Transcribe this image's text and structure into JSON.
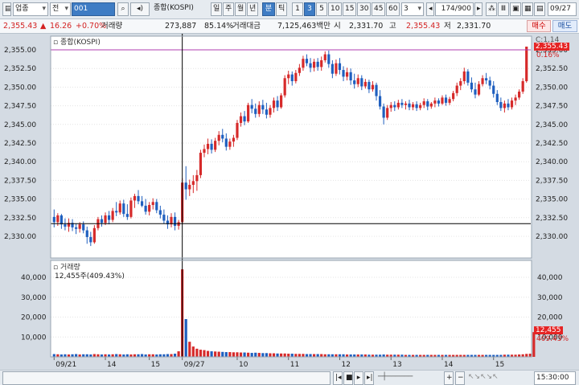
{
  "toolbar": {
    "market": "업종",
    "type": "전",
    "code": "001",
    "name": "종합(KOSPI)",
    "periods": [
      "일",
      "주",
      "월",
      "년",
      "분",
      "틱"
    ],
    "selected_period": "분",
    "intervals": [
      "1",
      "3",
      "5",
      "10",
      "15",
      "30",
      "45",
      "60"
    ],
    "selected_interval": "3",
    "interval_select": "3",
    "count": "174/900",
    "date": "09/27"
  },
  "info": {
    "price": "2,355.43",
    "change_arrow": "▲",
    "change": "16.26",
    "change_pct": "+0.70%",
    "volume_label": "거래량",
    "volume": "273,887",
    "volume_pct": "85.14%",
    "amount_label": "거래대금",
    "amount": "7,125,463백만",
    "open_label": "시",
    "open": "2,331.70",
    "high_label": "고",
    "high": "2,355.43",
    "low_label": "저",
    "low": "2,331.70",
    "buy_label": "매수",
    "sell_label": "매도"
  },
  "price_panel": {
    "legend": "종합(KOSPI)",
    "corner_label": "C:1,14",
    "current_price_label": "2,355.43",
    "current_pct_label": "0.16%",
    "y_ticks": [
      "2,355.00",
      "2,352.50",
      "2,350.00",
      "2,347.50",
      "2,345.00",
      "2,342.50",
      "2,340.00",
      "2,337.50",
      "2,335.00",
      "2,332.50",
      "2,330.00"
    ]
  },
  "volume_panel": {
    "legend": "거래량",
    "current_label": "12,455주(409.43%)",
    "current_value_label": "12,455",
    "current_pct_label": "409.43%",
    "y_ticks": [
      "40,000",
      "30,000",
      "20,000",
      "10,000"
    ]
  },
  "x_axis": {
    "labels": [
      "09/21",
      "14",
      "15",
      "09/27",
      "10",
      "11",
      "12",
      "13",
      "14",
      "15"
    ],
    "time_label": "15:30:00"
  },
  "colors": {
    "up": "#d62a2a",
    "down": "#1f5fbf",
    "crosshair": "#000000",
    "high_line": "#b23cb2"
  },
  "chart_data": {
    "type": "candlestick",
    "title": "종합(KOSPI)",
    "interval": "3분",
    "ylim": [
      2328.0,
      2356.0
    ],
    "crosshair_price": 2331.7,
    "candles": [
      {
        "o": 2332.6,
        "h": 2333.6,
        "l": 2331.2,
        "c": 2331.9
      },
      {
        "o": 2331.9,
        "h": 2333.1,
        "l": 2331.4,
        "c": 2332.8
      },
      {
        "o": 2332.8,
        "h": 2333.0,
        "l": 2331.0,
        "c": 2331.6
      },
      {
        "o": 2331.6,
        "h": 2332.4,
        "l": 2330.8,
        "c": 2331.3
      },
      {
        "o": 2331.3,
        "h": 2332.4,
        "l": 2330.6,
        "c": 2331.8
      },
      {
        "o": 2331.8,
        "h": 2332.3,
        "l": 2330.7,
        "c": 2331.2
      },
      {
        "o": 2331.2,
        "h": 2331.7,
        "l": 2330.3,
        "c": 2331.0
      },
      {
        "o": 2331.0,
        "h": 2331.9,
        "l": 2330.5,
        "c": 2331.6
      },
      {
        "o": 2331.6,
        "h": 2332.0,
        "l": 2330.4,
        "c": 2330.8
      },
      {
        "o": 2330.8,
        "h": 2331.3,
        "l": 2329.0,
        "c": 2329.9
      },
      {
        "o": 2329.9,
        "h": 2330.6,
        "l": 2328.7,
        "c": 2329.2
      },
      {
        "o": 2329.2,
        "h": 2331.5,
        "l": 2329.0,
        "c": 2331.1
      },
      {
        "o": 2331.1,
        "h": 2332.6,
        "l": 2330.8,
        "c": 2332.3
      },
      {
        "o": 2332.3,
        "h": 2332.8,
        "l": 2331.3,
        "c": 2331.8
      },
      {
        "o": 2331.8,
        "h": 2333.2,
        "l": 2331.5,
        "c": 2332.8
      },
      {
        "o": 2332.8,
        "h": 2333.4,
        "l": 2331.6,
        "c": 2332.2
      },
      {
        "o": 2332.2,
        "h": 2333.8,
        "l": 2331.9,
        "c": 2333.4
      },
      {
        "o": 2333.4,
        "h": 2334.6,
        "l": 2332.7,
        "c": 2333.2
      },
      {
        "o": 2333.2,
        "h": 2334.8,
        "l": 2332.9,
        "c": 2334.4
      },
      {
        "o": 2334.4,
        "h": 2334.9,
        "l": 2332.6,
        "c": 2333.0
      },
      {
        "o": 2333.0,
        "h": 2334.3,
        "l": 2332.2,
        "c": 2332.6
      },
      {
        "o": 2332.6,
        "h": 2335.2,
        "l": 2332.4,
        "c": 2334.8
      },
      {
        "o": 2334.8,
        "h": 2335.7,
        "l": 2333.8,
        "c": 2335.4
      },
      {
        "o": 2335.4,
        "h": 2336.2,
        "l": 2334.3,
        "c": 2334.7
      },
      {
        "o": 2334.7,
        "h": 2335.4,
        "l": 2333.9,
        "c": 2334.1
      },
      {
        "o": 2334.1,
        "h": 2335.0,
        "l": 2332.9,
        "c": 2333.3
      },
      {
        "o": 2333.3,
        "h": 2334.6,
        "l": 2332.8,
        "c": 2334.2
      },
      {
        "o": 2334.2,
        "h": 2335.1,
        "l": 2333.6,
        "c": 2334.6
      },
      {
        "o": 2334.6,
        "h": 2335.0,
        "l": 2333.1,
        "c": 2333.5
      },
      {
        "o": 2333.5,
        "h": 2334.1,
        "l": 2332.4,
        "c": 2332.9
      },
      {
        "o": 2332.9,
        "h": 2333.6,
        "l": 2331.7,
        "c": 2332.1
      },
      {
        "o": 2332.1,
        "h": 2332.8,
        "l": 2331.0,
        "c": 2331.6
      },
      {
        "o": 2331.6,
        "h": 2333.1,
        "l": 2331.2,
        "c": 2332.6
      },
      {
        "o": 2332.6,
        "h": 2333.2,
        "l": 2330.8,
        "c": 2331.4
      },
      {
        "o": 2331.4,
        "h": 2332.2,
        "l": 2330.9,
        "c": 2331.9
      },
      {
        "o": 2331.9,
        "h": 2337.8,
        "l": 2331.6,
        "c": 2337.2
      },
      {
        "o": 2337.2,
        "h": 2339.4,
        "l": 2334.9,
        "c": 2336.3
      },
      {
        "o": 2336.3,
        "h": 2337.6,
        "l": 2335.4,
        "c": 2336.9
      },
      {
        "o": 2336.9,
        "h": 2338.2,
        "l": 2335.8,
        "c": 2337.4
      },
      {
        "o": 2337.4,
        "h": 2338.9,
        "l": 2336.1,
        "c": 2338.2
      },
      {
        "o": 2338.2,
        "h": 2341.6,
        "l": 2337.8,
        "c": 2341.2
      },
      {
        "o": 2341.2,
        "h": 2342.3,
        "l": 2340.6,
        "c": 2341.7
      },
      {
        "o": 2341.7,
        "h": 2343.1,
        "l": 2341.0,
        "c": 2342.4
      },
      {
        "o": 2342.4,
        "h": 2343.0,
        "l": 2341.1,
        "c": 2341.6
      },
      {
        "o": 2341.6,
        "h": 2343.2,
        "l": 2341.3,
        "c": 2342.8
      },
      {
        "o": 2342.8,
        "h": 2344.1,
        "l": 2342.2,
        "c": 2343.6
      },
      {
        "o": 2343.6,
        "h": 2344.4,
        "l": 2342.6,
        "c": 2343.1
      },
      {
        "o": 2343.1,
        "h": 2343.8,
        "l": 2341.5,
        "c": 2342.0
      },
      {
        "o": 2342.0,
        "h": 2343.1,
        "l": 2341.6,
        "c": 2342.7
      },
      {
        "o": 2342.7,
        "h": 2343.6,
        "l": 2342.0,
        "c": 2343.2
      },
      {
        "o": 2343.2,
        "h": 2345.6,
        "l": 2342.9,
        "c": 2345.2
      },
      {
        "o": 2345.2,
        "h": 2346.6,
        "l": 2344.7,
        "c": 2346.1
      },
      {
        "o": 2346.1,
        "h": 2346.8,
        "l": 2344.9,
        "c": 2345.4
      },
      {
        "o": 2345.4,
        "h": 2347.9,
        "l": 2345.2,
        "c": 2347.6
      },
      {
        "o": 2347.6,
        "h": 2348.4,
        "l": 2346.5,
        "c": 2347.1
      },
      {
        "o": 2347.1,
        "h": 2347.8,
        "l": 2345.9,
        "c": 2346.4
      },
      {
        "o": 2346.4,
        "h": 2348.1,
        "l": 2346.0,
        "c": 2347.6
      },
      {
        "o": 2347.6,
        "h": 2348.3,
        "l": 2346.4,
        "c": 2347.0
      },
      {
        "o": 2347.0,
        "h": 2347.9,
        "l": 2345.8,
        "c": 2346.3
      },
      {
        "o": 2346.3,
        "h": 2347.6,
        "l": 2345.9,
        "c": 2347.2
      },
      {
        "o": 2347.2,
        "h": 2348.6,
        "l": 2346.6,
        "c": 2348.2
      },
      {
        "o": 2348.2,
        "h": 2348.8,
        "l": 2346.8,
        "c": 2347.3
      },
      {
        "o": 2347.3,
        "h": 2349.2,
        "l": 2347.1,
        "c": 2348.9
      },
      {
        "o": 2348.9,
        "h": 2351.6,
        "l": 2348.6,
        "c": 2351.2
      },
      {
        "o": 2351.2,
        "h": 2352.2,
        "l": 2350.4,
        "c": 2351.7
      },
      {
        "o": 2351.7,
        "h": 2352.1,
        "l": 2350.2,
        "c": 2350.8
      },
      {
        "o": 2350.8,
        "h": 2352.3,
        "l": 2350.5,
        "c": 2351.9
      },
      {
        "o": 2351.9,
        "h": 2353.1,
        "l": 2351.5,
        "c": 2352.6
      },
      {
        "o": 2352.6,
        "h": 2354.2,
        "l": 2352.2,
        "c": 2353.8
      },
      {
        "o": 2353.8,
        "h": 2354.4,
        "l": 2352.8,
        "c": 2353.2
      },
      {
        "o": 2353.2,
        "h": 2353.9,
        "l": 2352.0,
        "c": 2352.6
      },
      {
        "o": 2352.6,
        "h": 2353.8,
        "l": 2352.1,
        "c": 2353.4
      },
      {
        "o": 2353.4,
        "h": 2353.9,
        "l": 2352.2,
        "c": 2352.7
      },
      {
        "o": 2352.7,
        "h": 2354.1,
        "l": 2352.2,
        "c": 2353.6
      },
      {
        "o": 2353.6,
        "h": 2354.8,
        "l": 2353.3,
        "c": 2354.4
      },
      {
        "o": 2354.4,
        "h": 2354.9,
        "l": 2352.6,
        "c": 2353.1
      },
      {
        "o": 2353.1,
        "h": 2353.6,
        "l": 2351.2,
        "c": 2351.8
      },
      {
        "o": 2351.8,
        "h": 2353.7,
        "l": 2351.5,
        "c": 2353.2
      },
      {
        "o": 2353.2,
        "h": 2353.9,
        "l": 2351.7,
        "c": 2352.3
      },
      {
        "o": 2352.3,
        "h": 2352.8,
        "l": 2350.8,
        "c": 2351.4
      },
      {
        "o": 2351.4,
        "h": 2352.6,
        "l": 2350.9,
        "c": 2352.0
      },
      {
        "o": 2352.0,
        "h": 2352.5,
        "l": 2350.3,
        "c": 2350.9
      },
      {
        "o": 2350.9,
        "h": 2351.8,
        "l": 2349.8,
        "c": 2350.4
      },
      {
        "o": 2350.4,
        "h": 2351.7,
        "l": 2350.0,
        "c": 2351.2
      },
      {
        "o": 2351.2,
        "h": 2351.6,
        "l": 2349.6,
        "c": 2350.1
      },
      {
        "o": 2350.1,
        "h": 2351.1,
        "l": 2349.8,
        "c": 2350.7
      },
      {
        "o": 2350.7,
        "h": 2351.0,
        "l": 2349.2,
        "c": 2349.7
      },
      {
        "o": 2349.7,
        "h": 2350.8,
        "l": 2349.4,
        "c": 2350.3
      },
      {
        "o": 2350.3,
        "h": 2350.6,
        "l": 2348.2,
        "c": 2348.8
      },
      {
        "o": 2348.8,
        "h": 2349.6,
        "l": 2347.0,
        "c": 2347.4
      },
      {
        "o": 2347.4,
        "h": 2347.8,
        "l": 2345.0,
        "c": 2345.9
      },
      {
        "o": 2345.9,
        "h": 2347.6,
        "l": 2345.6,
        "c": 2347.2
      },
      {
        "o": 2347.2,
        "h": 2348.0,
        "l": 2346.7,
        "c": 2347.6
      },
      {
        "o": 2347.6,
        "h": 2348.1,
        "l": 2346.8,
        "c": 2347.3
      },
      {
        "o": 2347.3,
        "h": 2348.3,
        "l": 2347.0,
        "c": 2347.9
      },
      {
        "o": 2347.9,
        "h": 2348.4,
        "l": 2347.2,
        "c": 2347.6
      },
      {
        "o": 2347.6,
        "h": 2348.1,
        "l": 2347.0,
        "c": 2347.8
      },
      {
        "o": 2347.8,
        "h": 2348.3,
        "l": 2346.9,
        "c": 2347.3
      },
      {
        "o": 2347.3,
        "h": 2348.0,
        "l": 2346.9,
        "c": 2347.7
      },
      {
        "o": 2347.7,
        "h": 2348.1,
        "l": 2346.8,
        "c": 2347.2
      },
      {
        "o": 2347.2,
        "h": 2347.9,
        "l": 2346.9,
        "c": 2347.6
      },
      {
        "o": 2347.6,
        "h": 2348.5,
        "l": 2347.2,
        "c": 2348.1
      },
      {
        "o": 2348.1,
        "h": 2348.4,
        "l": 2346.9,
        "c": 2347.4
      },
      {
        "o": 2347.4,
        "h": 2348.0,
        "l": 2347.1,
        "c": 2347.8
      },
      {
        "o": 2347.8,
        "h": 2348.6,
        "l": 2347.3,
        "c": 2348.2
      },
      {
        "o": 2348.2,
        "h": 2348.5,
        "l": 2347.4,
        "c": 2347.8
      },
      {
        "o": 2347.8,
        "h": 2348.9,
        "l": 2347.6,
        "c": 2348.6
      },
      {
        "o": 2348.6,
        "h": 2349.0,
        "l": 2347.5,
        "c": 2347.9
      },
      {
        "o": 2347.9,
        "h": 2348.7,
        "l": 2347.6,
        "c": 2348.4
      },
      {
        "o": 2348.4,
        "h": 2349.5,
        "l": 2348.1,
        "c": 2349.2
      },
      {
        "o": 2349.2,
        "h": 2350.6,
        "l": 2348.8,
        "c": 2350.2
      },
      {
        "o": 2350.2,
        "h": 2351.2,
        "l": 2349.6,
        "c": 2350.8
      },
      {
        "o": 2350.8,
        "h": 2352.6,
        "l": 2350.4,
        "c": 2352.1
      },
      {
        "o": 2352.1,
        "h": 2352.4,
        "l": 2350.2,
        "c": 2350.6
      },
      {
        "o": 2350.6,
        "h": 2351.3,
        "l": 2349.3,
        "c": 2349.7
      },
      {
        "o": 2349.7,
        "h": 2350.6,
        "l": 2348.5,
        "c": 2349.0
      },
      {
        "o": 2349.0,
        "h": 2350.8,
        "l": 2348.8,
        "c": 2350.4
      },
      {
        "o": 2350.4,
        "h": 2351.6,
        "l": 2350.1,
        "c": 2351.2
      },
      {
        "o": 2351.2,
        "h": 2351.9,
        "l": 2350.4,
        "c": 2350.9
      },
      {
        "o": 2350.9,
        "h": 2351.4,
        "l": 2349.7,
        "c": 2350.2
      },
      {
        "o": 2350.2,
        "h": 2350.8,
        "l": 2348.6,
        "c": 2349.1
      },
      {
        "o": 2349.1,
        "h": 2349.6,
        "l": 2347.6,
        "c": 2348.0
      },
      {
        "o": 2348.0,
        "h": 2348.6,
        "l": 2346.8,
        "c": 2347.2
      },
      {
        "o": 2347.2,
        "h": 2348.2,
        "l": 2346.6,
        "c": 2347.8
      },
      {
        "o": 2347.8,
        "h": 2348.4,
        "l": 2346.9,
        "c": 2347.3
      },
      {
        "o": 2347.3,
        "h": 2348.6,
        "l": 2347.0,
        "c": 2348.2
      },
      {
        "o": 2348.2,
        "h": 2349.0,
        "l": 2347.6,
        "c": 2348.6
      },
      {
        "o": 2348.6,
        "h": 2349.7,
        "l": 2348.3,
        "c": 2349.4
      },
      {
        "o": 2349.4,
        "h": 2351.2,
        "l": 2349.1,
        "c": 2350.8
      },
      {
        "o": 2350.8,
        "h": 2355.43,
        "l": 2350.6,
        "c": 2355.43
      }
    ],
    "volume": [
      1400,
      1300,
      1200,
      1300,
      1200,
      1300,
      1400,
      1200,
      1300,
      1300,
      1200,
      1400,
      1300,
      1200,
      1300,
      1200,
      1300,
      1400,
      1300,
      1200,
      1300,
      1200,
      1300,
      1300,
      1400,
      1200,
      1300,
      1300,
      1200,
      1300,
      1300,
      1400,
      1400,
      1600,
      2800,
      44000,
      19000,
      7600,
      5200,
      4100,
      3600,
      3400,
      3000,
      2800,
      2700,
      2600,
      2500,
      2400,
      2400,
      2300,
      2300,
      2200,
      2200,
      2100,
      2000,
      2100,
      2000,
      1900,
      1900,
      1800,
      1800,
      1700,
      1700,
      1700,
      1600,
      1600,
      1500,
      1500,
      1500,
      1400,
      1400,
      1400,
      1400,
      1400,
      1300,
      1300,
      1300,
      1300,
      1300,
      1300,
      1200,
      1200,
      1200,
      1200,
      1200,
      1200,
      1100,
      1100,
      1100,
      1100,
      1200,
      1100,
      1100,
      1100,
      1100,
      1100,
      1000,
      1000,
      1000,
      1000,
      1000,
      1000,
      1000,
      1000,
      1000,
      1000,
      1000,
      1000,
      1000,
      1000,
      1000,
      1000,
      1000,
      1000,
      1000,
      1000,
      1000,
      1000,
      1000,
      1000,
      1000,
      1000,
      1000,
      1100,
      1100,
      1100,
      1100,
      1200,
      1300,
      1500,
      1600,
      12455
    ],
    "volume_ylim": [
      0,
      48000
    ]
  }
}
